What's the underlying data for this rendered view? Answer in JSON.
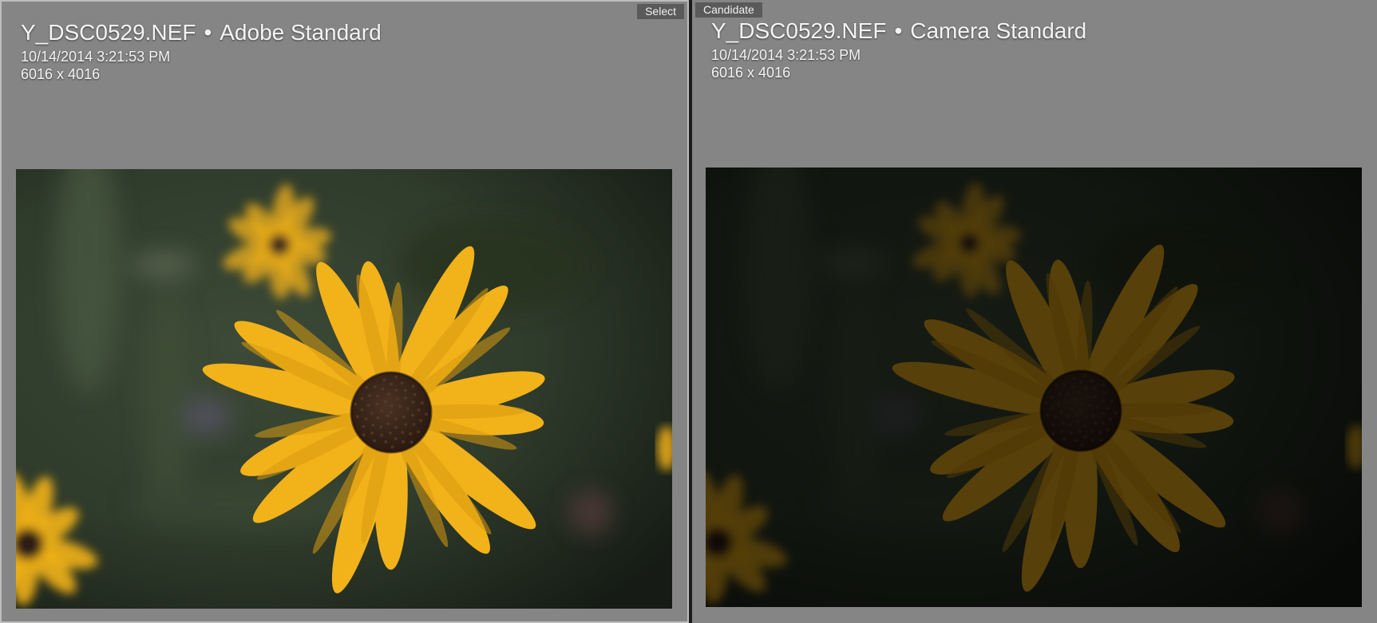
{
  "left": {
    "tag": "Select",
    "filename": "Y_DSC0529.NEF",
    "separator": "•",
    "profile": "Adobe Standard",
    "datetime": "10/14/2014 3:21:53 PM",
    "dimensions": "6016 x 4016",
    "photo_subject": "yellow black-eyed susan flower"
  },
  "right": {
    "tag": "Candidate",
    "filename": "Y_DSC0529.NEF",
    "separator": "•",
    "profile": "Camera Standard",
    "datetime": "10/14/2014 3:21:53 PM",
    "dimensions": "6016 x 4016",
    "photo_subject": "yellow black-eyed susan flower, darker rendering"
  },
  "colors": {
    "panel_bg": "#858585",
    "tag_bg": "#5a5a5a",
    "petal": "#f2b21a",
    "center": "#2b1a12",
    "background_green": "#2f3b2b"
  }
}
